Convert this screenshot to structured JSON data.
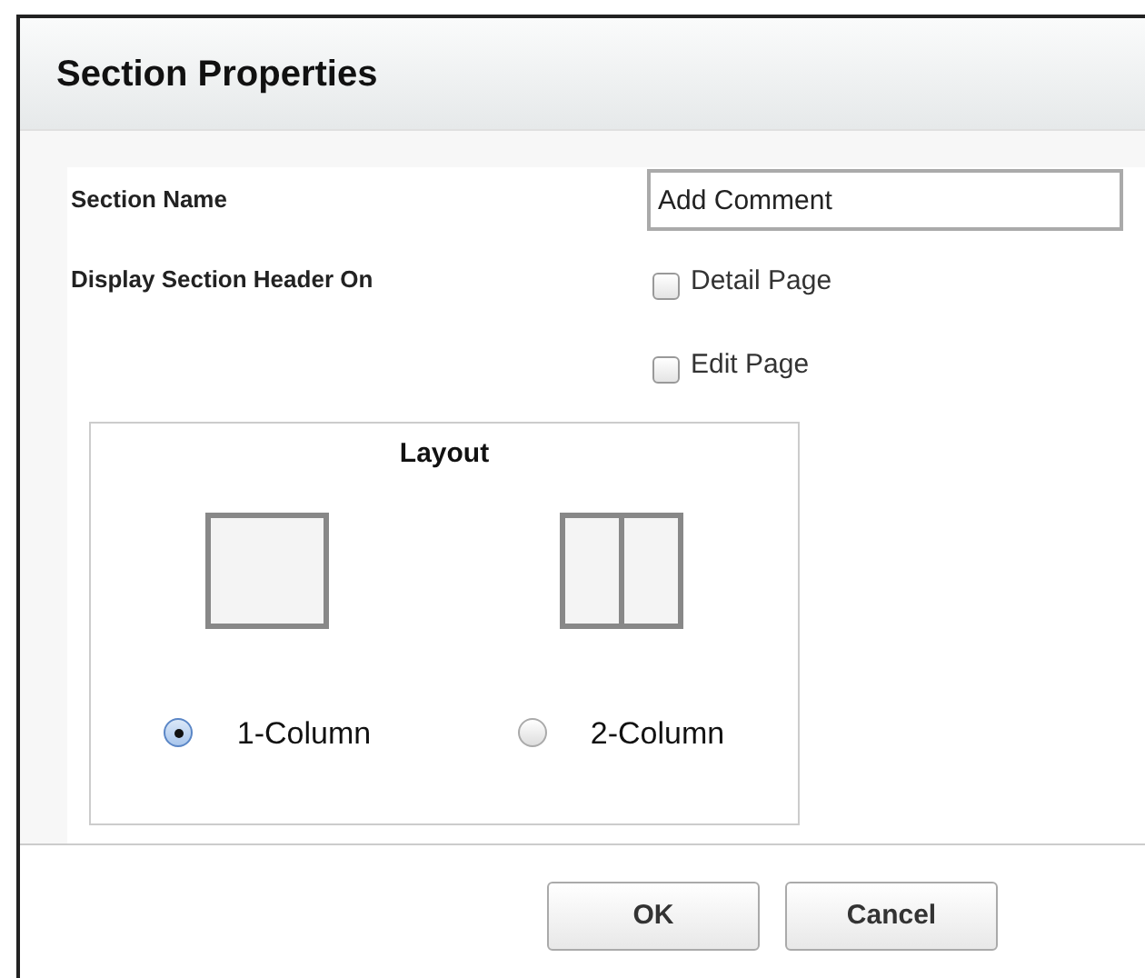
{
  "window": {
    "title": "Section Properties"
  },
  "section_name": {
    "label": "Section Name",
    "value": "Add Comment"
  },
  "display_header": {
    "label": "Display Section Header On",
    "options": [
      {
        "label": "Detail Page",
        "checked": false
      },
      {
        "label": "Edit Page",
        "checked": false
      }
    ]
  },
  "layout": {
    "title": "Layout",
    "options": [
      {
        "kind": "one-column",
        "label": "1-Column",
        "selected": true
      },
      {
        "kind": "two-column",
        "label": "2-Column",
        "selected": false
      }
    ]
  },
  "buttons": [
    "OK",
    "Cancel"
  ]
}
